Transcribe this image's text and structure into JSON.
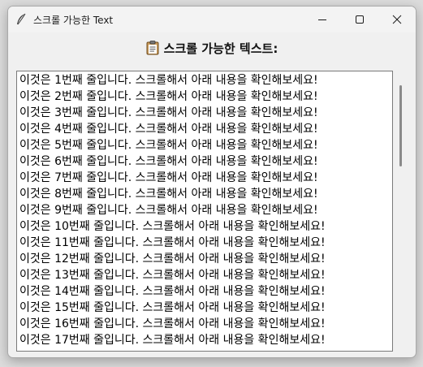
{
  "window": {
    "title": "스크롤 가능한 Text",
    "app_icon": "feather-icon",
    "controls": [
      "minimize-icon",
      "maximize-icon",
      "close-icon"
    ]
  },
  "heading": {
    "icon": "clipboard-icon",
    "text": "스크롤 가능한 텍스트:"
  },
  "textbox": {
    "lines": [
      "이것은 1번째 줄입니다. 스크롤해서 아래 내용을 확인해보세요!",
      "이것은 2번째 줄입니다. 스크롤해서 아래 내용을 확인해보세요!",
      "이것은 3번째 줄입니다. 스크롤해서 아래 내용을 확인해보세요!",
      "이것은 4번째 줄입니다. 스크롤해서 아래 내용을 확인해보세요!",
      "이것은 5번째 줄입니다. 스크롤해서 아래 내용을 확인해보세요!",
      "이것은 6번째 줄입니다. 스크롤해서 아래 내용을 확인해보세요!",
      "이것은 7번째 줄입니다. 스크롤해서 아래 내용을 확인해보세요!",
      "이것은 8번째 줄입니다. 스크롤해서 아래 내용을 확인해보세요!",
      "이것은 9번째 줄입니다. 스크롤해서 아래 내용을 확인해보세요!",
      "이것은 10번째 줄입니다. 스크롤해서 아래 내용을 확인해보세요!",
      "이것은 11번째 줄입니다. 스크롤해서 아래 내용을 확인해보세요!",
      "이것은 12번째 줄입니다. 스크롤해서 아래 내용을 확인해보세요!",
      "이것은 13번째 줄입니다. 스크롤해서 아래 내용을 확인해보세요!",
      "이것은 14번째 줄입니다. 스크롤해서 아래 내용을 확인해보세요!",
      "이것은 15번째 줄입니다. 스크롤해서 아래 내용을 확인해보세요!",
      "이것은 16번째 줄입니다. 스크롤해서 아래 내용을 확인해보세요!",
      "이것은 17번째 줄입니다. 스크롤해서 아래 내용을 확인해보세요!"
    ]
  },
  "scrollbar": {
    "visible_fraction": 0.29,
    "scroll_position": 0
  }
}
